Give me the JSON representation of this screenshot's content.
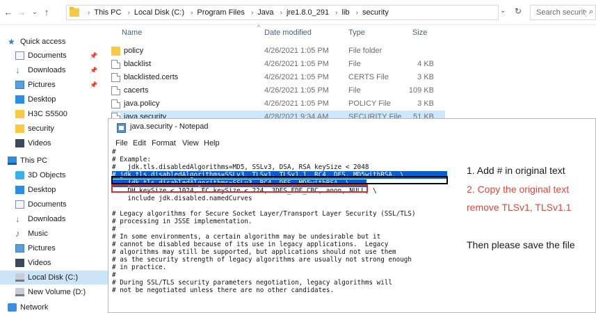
{
  "address_bar": {
    "back": "←",
    "forward": "→",
    "recent": "⌄",
    "up": "↑",
    "breadcrumbs": [
      "This PC",
      "Local Disk (C:)",
      "Program Files",
      "Java",
      "jre1.8.0_291",
      "lib",
      "security"
    ],
    "search_placeholder": "Search security"
  },
  "nav": {
    "items": [
      {
        "label": "Quick access"
      },
      {
        "label": "Documents"
      },
      {
        "label": "Downloads"
      },
      {
        "label": "Pictures"
      },
      {
        "label": "Desktop"
      },
      {
        "label": "H3C S5500"
      },
      {
        "label": "security"
      },
      {
        "label": "Videos"
      },
      {
        "label": "This PC"
      },
      {
        "label": "3D Objects"
      },
      {
        "label": "Desktop"
      },
      {
        "label": "Documents"
      },
      {
        "label": "Downloads"
      },
      {
        "label": "Music"
      },
      {
        "label": "Pictures"
      },
      {
        "label": "Videos"
      },
      {
        "label": "Local Disk (C:)"
      },
      {
        "label": "New Volume (D:)"
      },
      {
        "label": "Network"
      }
    ]
  },
  "filelist": {
    "columns": [
      "Name",
      "Date modified",
      "Type",
      "Size"
    ],
    "rows": [
      {
        "name": "policy",
        "date": "4/26/2021 1:05 PM",
        "type": "File folder",
        "size": ""
      },
      {
        "name": "blacklist",
        "date": "4/26/2021 1:05 PM",
        "type": "File",
        "size": "4 KB"
      },
      {
        "name": "blacklisted.certs",
        "date": "4/26/2021 1:05 PM",
        "type": "CERTS File",
        "size": "3 KB"
      },
      {
        "name": "cacerts",
        "date": "4/26/2021 1:05 PM",
        "type": "File",
        "size": "109 KB"
      },
      {
        "name": "java.policy",
        "date": "4/26/2021 1:05 PM",
        "type": "POLICY File",
        "size": "3 KB"
      },
      {
        "name": "java.security",
        "date": "4/28/2021 9:34 AM",
        "type": "SECURITY File",
        "size": "51 KB"
      }
    ]
  },
  "notepad": {
    "title": "java.security - Notepad",
    "menu": [
      "File",
      "Edit",
      "Format",
      "View",
      "Help"
    ],
    "lines": [
      "#",
      "# Example:",
      "#   jdk.tls.disabledAlgorithms=MD5, SSLv3, DSA, RSA keySize < 2048",
      "# jdk.tls.disabledAlgorithms=SSLv3, TLSv1, TLSv1.1, RC4, DES, MD5withRSA, \\",
      "    jdk.tls.disabledAlgorithms=SSLv3, RC4, DES, MD5withRSA, \\",
      "    DH keySize < 1024, EC keySize < 224, 3DES_EDE_CBC, anon, NULL, \\",
      "    include jdk.disabled.namedCurves",
      "",
      "# Legacy algorithms for Secure Socket Layer/Transport Layer Security (SSL/TLS)",
      "# processing in JSSE implementation.",
      "#",
      "# In some environments, a certain algorithm may be undesirable but it",
      "# cannot be disabled because of its use in legacy applications.  Legacy",
      "# algorithms may still be supported, but applications should not use them",
      "# as the security strength of legacy algorithms are usually not strong enough",
      "# in practice.",
      "#",
      "# During SSL/TLS security parameters negotiation, legacy algorithms will",
      "# not be negotiated unless there are no other candidates."
    ]
  },
  "annotations": {
    "step1": "1. Add # in original text",
    "step2_line1": "2. Copy the original text",
    "step2_line2": "remove TLSv1, TLSv1.1",
    "step3": "Then please save the file"
  },
  "colors": {
    "selection": "#0a5fd0",
    "annotation_red": "#e0463a",
    "highlight_box_red": "#d92d2d"
  }
}
